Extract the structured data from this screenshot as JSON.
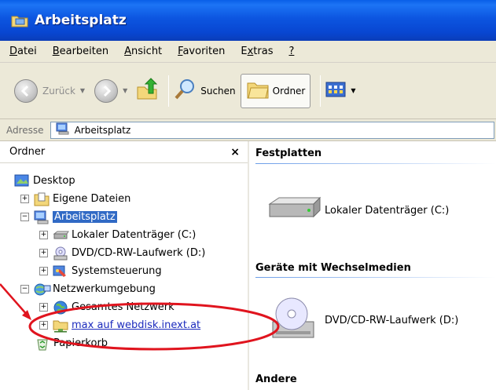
{
  "window": {
    "title": "Arbeitsplatz"
  },
  "menu": {
    "items": [
      {
        "label": "Datei",
        "accel": "D",
        "rest": "atei"
      },
      {
        "label": "Bearbeiten",
        "accel": "B",
        "rest": "earbeiten"
      },
      {
        "label": "Ansicht",
        "accel": "A",
        "rest": "nsicht"
      },
      {
        "label": "Favoriten",
        "accel": "F",
        "rest": "avoriten"
      },
      {
        "label": "Extras",
        "pre": "E",
        "accel": "x",
        "rest": "tras"
      },
      {
        "label": "?",
        "accel": "?",
        "rest": ""
      }
    ]
  },
  "toolbar": {
    "back_label": "Zurück",
    "search_label": "Suchen",
    "folders_label": "Ordner"
  },
  "address": {
    "label": "Adresse",
    "value": "Arbeitsplatz"
  },
  "folders_panel": {
    "title": "Ordner",
    "close": "×",
    "tree": [
      {
        "label": "Desktop",
        "icon": "desktop-icon"
      },
      {
        "label": "Eigene Dateien",
        "icon": "documents-folder-icon"
      },
      {
        "label": "Arbeitsplatz",
        "icon": "computer-icon"
      },
      {
        "label": "Lokaler Datenträger (C:)",
        "icon": "hard-drive-icon"
      },
      {
        "label": "DVD/CD-RW-Laufwerk (D:)",
        "icon": "dvd-drive-icon"
      },
      {
        "label": "Systemsteuerung",
        "icon": "control-panel-icon"
      },
      {
        "label": "Netzwerkumgebung",
        "icon": "network-icon"
      },
      {
        "label": "Gesamtes Netzwerk",
        "icon": "globe-icon"
      },
      {
        "label": "max auf webdisk.inext.at",
        "icon": "network-folder-icon"
      },
      {
        "label": "Papierkorb",
        "icon": "recycle-bin-icon"
      }
    ]
  },
  "content": {
    "sections": [
      {
        "title": "Festplatten",
        "items": [
          {
            "label": "Lokaler Datenträger (C:)",
            "icon": "hard-drive-icon"
          }
        ]
      },
      {
        "title": "Geräte mit Wechselmedien",
        "items": [
          {
            "label": "DVD/CD-RW-Laufwerk (D:)",
            "icon": "dvd-drive-icon"
          }
        ]
      },
      {
        "title": "Andere",
        "items": []
      }
    ]
  },
  "colors": {
    "titlebar": "#0c55e0",
    "selection": "#316ac5",
    "link": "#1c2bbd",
    "annotation": "#e0141e"
  }
}
